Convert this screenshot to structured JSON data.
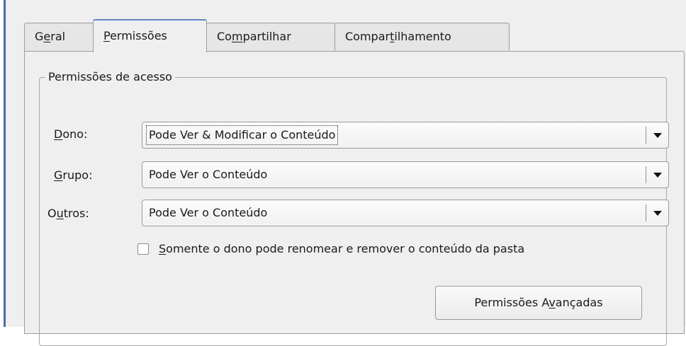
{
  "tabs": [
    {
      "pre": "G",
      "key": "e",
      "post": "ral",
      "active": false
    },
    {
      "pre": "",
      "key": "P",
      "post": "ermissões",
      "active": true
    },
    {
      "pre": "Co",
      "key": "m",
      "post": "partilhar",
      "active": false
    },
    {
      "pre": "Compar",
      "key": "t",
      "post": "ilhamento",
      "active": false
    }
  ],
  "access": {
    "group_title": "Permissões de acesso",
    "owner": {
      "label_key": "D",
      "label_rest": "ono:",
      "value": "Pode Ver & Modificar o Conteúdo"
    },
    "group": {
      "label_key": "G",
      "label_rest": "rupo:",
      "value": "Pode Ver o Conteúdo"
    },
    "others": {
      "label_pre": "O",
      "label_key": "u",
      "label_rest": "tros:",
      "value": "Pode Ver o Conteúdo"
    },
    "checkbox": {
      "key": "S",
      "rest": "omente o dono pode renomear e remover o conteúdo da pasta",
      "checked": false
    },
    "advanced_button": {
      "pre": "Permissões A",
      "key": "v",
      "post": "ançadas"
    }
  },
  "colors": {
    "active_tab_accent": "#5d86c4",
    "window_bg": "#efefef",
    "left_border": "#4a6aa8"
  }
}
